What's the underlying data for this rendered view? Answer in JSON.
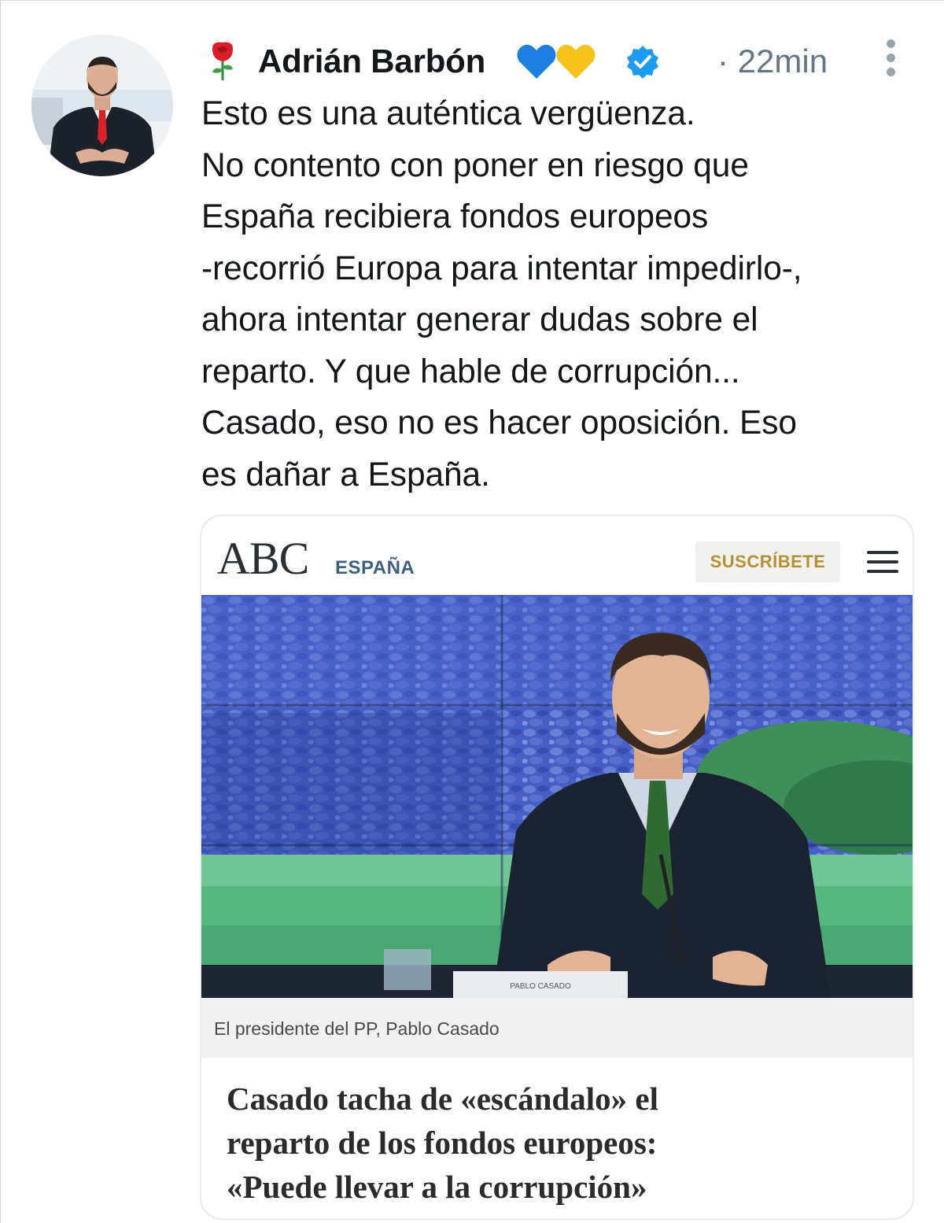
{
  "tweet": {
    "author_name": "Adrián Barbón",
    "timestamp": "· 22min",
    "text_lines": [
      "Esto es una auténtica vergüenza.",
      "No contento con poner en riesgo que",
      "España recibiera fondos europeos",
      "-recorrió Europa para intentar impedirlo-,",
      "ahora intentar generar dudas sobre el",
      "reparto. Y que hable de corrupción...",
      "Casado, eso no es hacer oposición. Eso",
      "es dañar a España."
    ],
    "icons": [
      "rose-icon",
      "blue-heart-icon",
      "yellow-heart-icon",
      "verified-badge-icon",
      "more-options-icon"
    ]
  },
  "card": {
    "site_logo": "ABC",
    "section": "ESPAÑA",
    "subscribe_label": "SUSCRÍBETE",
    "photo_nameplate": "PABLO CASADO",
    "photo_caption": "El presidente del PP, Pablo Casado",
    "headline_lines": [
      "Casado tacha de «escándalo» el",
      "reparto de los fondos europeos:",
      "«Puede llevar a la corrupción»"
    ]
  },
  "colors": {
    "verified_blue": "#1d9bf0",
    "timestamp_gray": "#657786",
    "subscribe_gold": "#b59033",
    "section_blue": "#3d5f80"
  }
}
